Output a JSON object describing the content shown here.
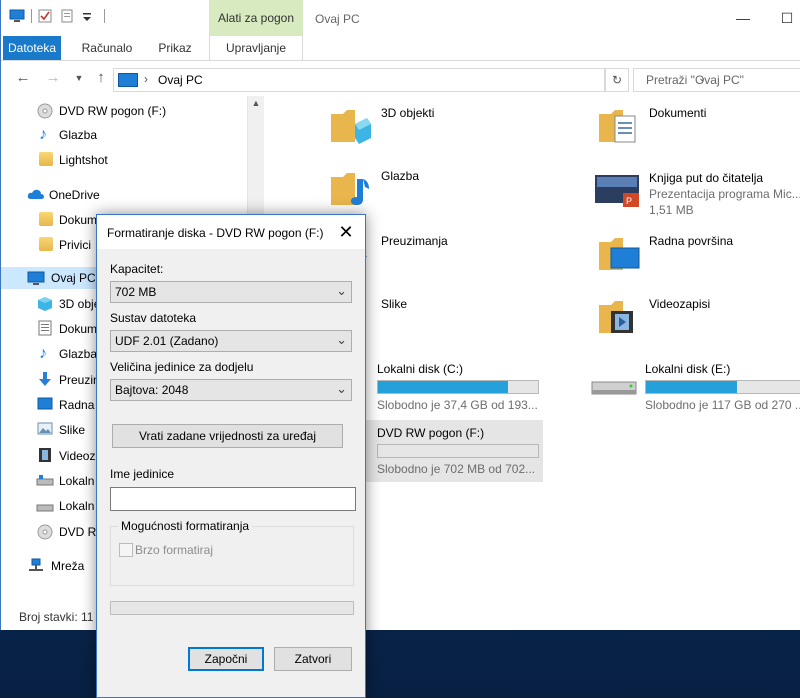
{
  "window": {
    "title": "Ovaj PC",
    "context_tab_header": "Alati za pogon"
  },
  "ribbon": {
    "tabs": [
      "Datoteka",
      "Računalo",
      "Prikaz",
      "Upravljanje"
    ]
  },
  "address": {
    "crumb": "Ovaj PC",
    "search_placeholder": "Pretraži \"Ovaj PC\""
  },
  "sidebar": {
    "items": [
      {
        "label": "DVD RW pogon (F:)",
        "icon": "dvd-drive-icon"
      },
      {
        "label": "Glazba",
        "icon": "music-note-icon"
      },
      {
        "label": "Lightshot",
        "icon": "folder-icon"
      },
      {
        "label": "OneDrive",
        "icon": "cloud-icon"
      },
      {
        "label": "Dokum",
        "icon": "folder-icon"
      },
      {
        "label": "Privici",
        "icon": "folder-icon"
      },
      {
        "label": "Ovaj PC",
        "icon": "computer-icon"
      },
      {
        "label": "3D obje",
        "icon": "cube-icon"
      },
      {
        "label": "Dokum",
        "icon": "document-icon"
      },
      {
        "label": "Glazba",
        "icon": "music-note-icon"
      },
      {
        "label": "Preuzim",
        "icon": "download-arrow-icon"
      },
      {
        "label": "Radna",
        "icon": "desktop-icon"
      },
      {
        "label": "Slike",
        "icon": "pictures-icon"
      },
      {
        "label": "Videoza",
        "icon": "film-icon"
      },
      {
        "label": "Lokaln",
        "icon": "windows-drive-icon"
      },
      {
        "label": "Lokaln",
        "icon": "drive-icon"
      },
      {
        "label": "DVD R",
        "icon": "dvd-drive-icon"
      },
      {
        "label": "Mreža",
        "icon": "network-icon"
      }
    ],
    "status": "Broj stavki: 11"
  },
  "content": {
    "folders": [
      {
        "name": "3D objekti",
        "icon": "3d-objects-folder-icon"
      },
      {
        "name": "Dokumenti",
        "icon": "documents-folder-icon"
      },
      {
        "name": "Glazba",
        "icon": "music-folder-icon"
      },
      {
        "name": "Preuzimanja",
        "icon": "downloads-folder-icon"
      },
      {
        "name": "Radna površina",
        "icon": "desktop-folder-icon"
      },
      {
        "name": "Slike",
        "icon": "pictures-folder-icon"
      },
      {
        "name": "Videozapisi",
        "icon": "videos-folder-icon"
      }
    ],
    "file": {
      "name": "Knjiga put do čitatelja",
      "type": "Prezentacija programa Mic...",
      "size": "1,51 MB"
    },
    "drives": [
      {
        "name": "Lokalni disk (C:)",
        "free": "Slobodno je 37,4 GB od 193...",
        "used_fraction": 0.81
      },
      {
        "name": "Lokalni disk (E:)",
        "free": "Slobodno je 117 GB od 270 ...",
        "used_fraction": 0.57
      },
      {
        "name": "DVD RW pogon (F:)",
        "free": "Slobodno je 702 MB od 702...",
        "used_fraction": 0.0
      }
    ]
  },
  "dialog": {
    "title": "Formatiranje diska - DVD RW pogon (F:)",
    "capacity_label": "Kapacitet:",
    "capacity_value": "702 MB",
    "fs_label": "Sustav datoteka",
    "fs_value": "UDF 2.01 (Zadano)",
    "alloc_label": "Veličina jedinice za dodjelu",
    "alloc_value": "Bajtova: 2048",
    "restore_button": "Vrati zadane vrijednosti za uređaj",
    "volume_label": "Ime jedinice",
    "volume_value": "",
    "options_label": "Mogućnosti formatiranja",
    "quick_format": "Brzo formatiraj",
    "start_button": "Započni",
    "close_button": "Zatvori"
  }
}
